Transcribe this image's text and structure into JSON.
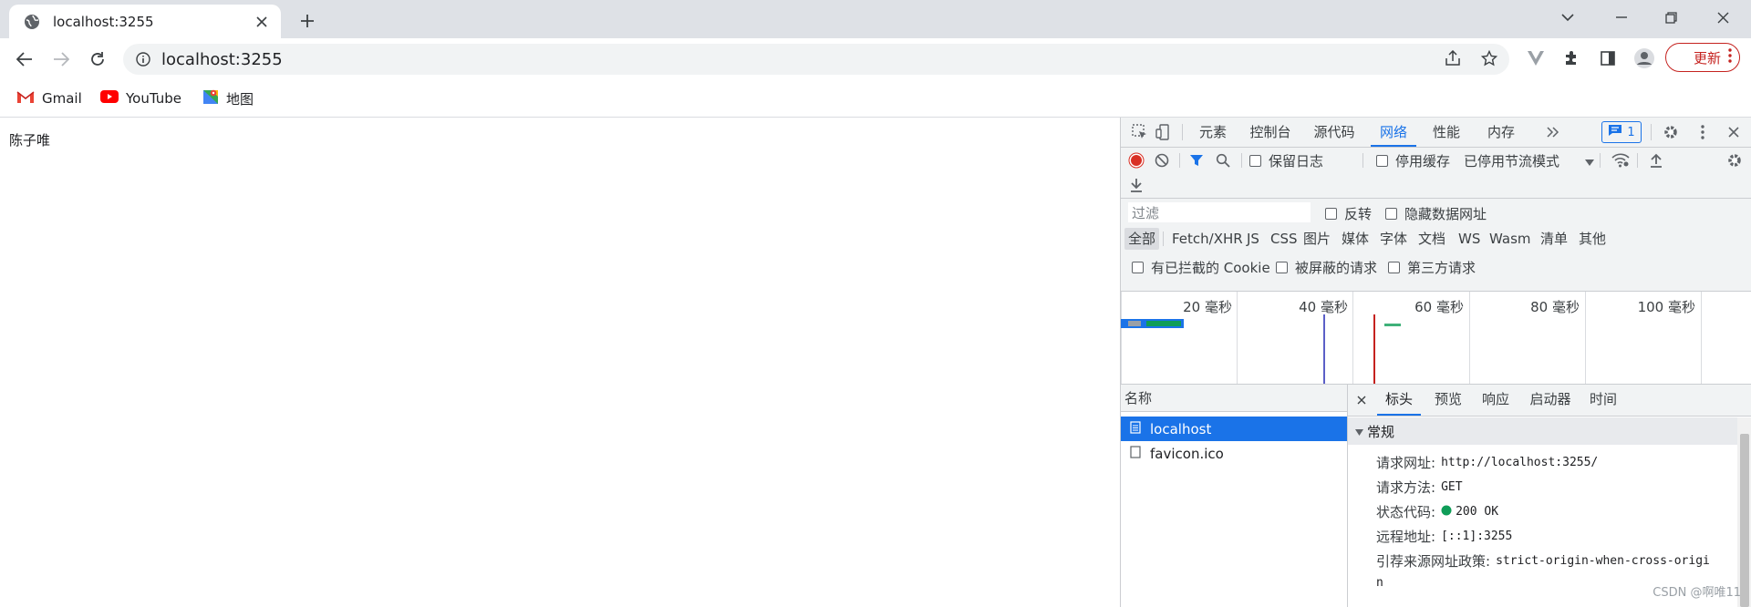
{
  "browser": {
    "tab_title": "localhost:3255",
    "url": "localhost:3255",
    "update_label": "更新",
    "bookmarks": [
      {
        "label": "Gmail",
        "icon": "gmail-icon"
      },
      {
        "label": "YouTube",
        "icon": "youtube-icon"
      },
      {
        "label": "地图",
        "icon": "maps-icon"
      }
    ]
  },
  "page": {
    "text": "陈子唯"
  },
  "devtools": {
    "tabs": [
      "元素",
      "控制台",
      "源代码",
      "网络",
      "性能",
      "内存"
    ],
    "active_tab": "网络",
    "issues_count": "1",
    "toolbar": {
      "preserve_log": "保留日志",
      "disable_cache": "停用缓存",
      "throttle": "已停用节流模式"
    },
    "filter": {
      "placeholder": "过滤",
      "invert": "反转",
      "hide_data_urls": "隐藏数据网址"
    },
    "types": [
      "全部",
      "Fetch/XHR",
      "JS",
      "CSS",
      "图片",
      "媒体",
      "字体",
      "文档",
      "WS",
      "Wasm",
      "清单",
      "其他"
    ],
    "cookie_filters": [
      "有已拦截的 Cookie",
      "被屏蔽的请求",
      "第三方请求"
    ],
    "overview_ticks": [
      "20 毫秒",
      "40 毫秒",
      "60 毫秒",
      "80 毫秒",
      "100 毫秒"
    ],
    "list_header": "名称",
    "requests": [
      {
        "name": "localhost",
        "selected": true
      },
      {
        "name": "favicon.ico",
        "selected": false
      }
    ],
    "detail_tabs": [
      "标头",
      "预览",
      "响应",
      "启动器",
      "时间"
    ],
    "section": "常规",
    "general": {
      "request_url_label": "请求网址:",
      "request_url": "http://localhost:3255/",
      "method_label": "请求方法:",
      "method": "GET",
      "status_label": "状态代码:",
      "status": "200 OK",
      "remote_label": "远程地址:",
      "remote": "[::1]:3255",
      "referrer_label": "引荐来源网址政策:",
      "referrer": "strict-origin-when-cross-origi",
      "referrer_wrap": "n"
    },
    "watermark": "CSDN @啊唯11",
    "colors": {
      "accent": "#1a73e8",
      "record": "#d93025",
      "status_ok": "#0f9d58"
    }
  }
}
